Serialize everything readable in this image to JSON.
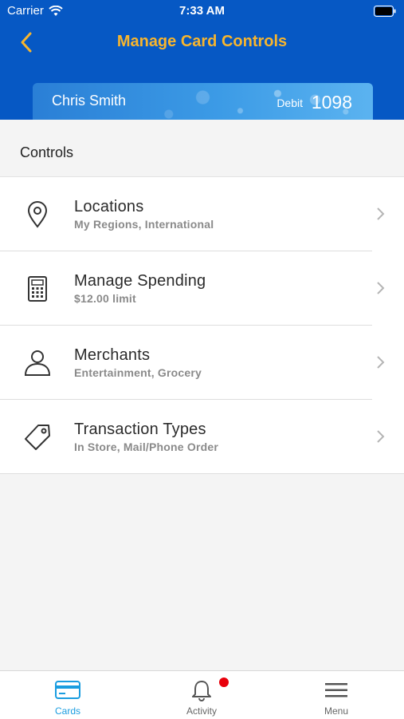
{
  "status_bar": {
    "carrier": "Carrier",
    "time": "7:33 AM"
  },
  "header": {
    "title": "Manage Card Controls",
    "title_color": "#f7b52e",
    "background": "#0658c4"
  },
  "card": {
    "holder_name": "Chris Smith",
    "type": "Debit",
    "last4": "1098"
  },
  "controls": {
    "section_title": "Controls",
    "items": [
      {
        "icon": "location-pin-icon",
        "title": "Locations",
        "subtitle": "My Regions, International"
      },
      {
        "icon": "calculator-icon",
        "title": "Manage Spending",
        "subtitle": "$12.00 limit"
      },
      {
        "icon": "person-icon",
        "title": "Merchants",
        "subtitle": "Entertainment, Grocery"
      },
      {
        "icon": "tag-icon",
        "title": "Transaction Types",
        "subtitle": "In Store, Mail/Phone Order"
      }
    ]
  },
  "tab_bar": {
    "active_color": "#1a9de0",
    "tabs": [
      {
        "label": "Cards",
        "icon": "card-icon",
        "active": true
      },
      {
        "label": "Activity",
        "icon": "bell-icon",
        "active": false,
        "badge": true
      },
      {
        "label": "Menu",
        "icon": "hamburger-menu-icon",
        "active": false
      }
    ]
  }
}
